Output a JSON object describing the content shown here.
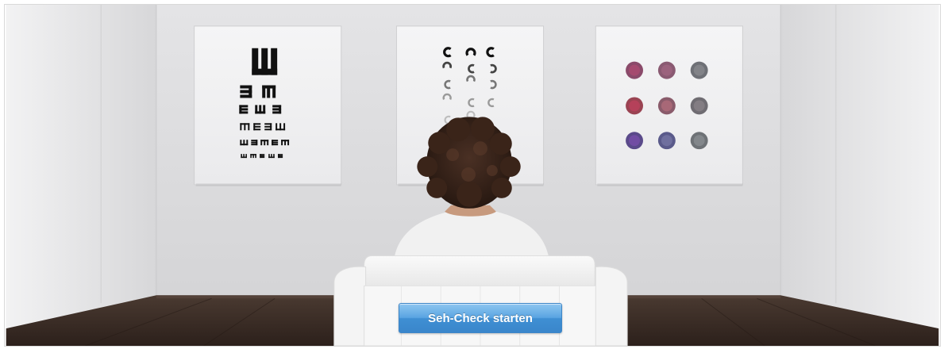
{
  "hero": {
    "scene": "Person seated in white armchair facing three vision test charts on a gallery wall",
    "charts": [
      {
        "name": "tumbling-e-chart"
      },
      {
        "name": "landolt-c-chart"
      },
      {
        "name": "color-plate-chart"
      }
    ]
  },
  "cta": {
    "label": "Seh-Check starten"
  },
  "colors": {
    "wall": "#dcdcdd",
    "floor": "#3a2c25",
    "button_top": "#8fc6f0",
    "button_bottom": "#3a86cb",
    "button_text": "#ffffff"
  }
}
